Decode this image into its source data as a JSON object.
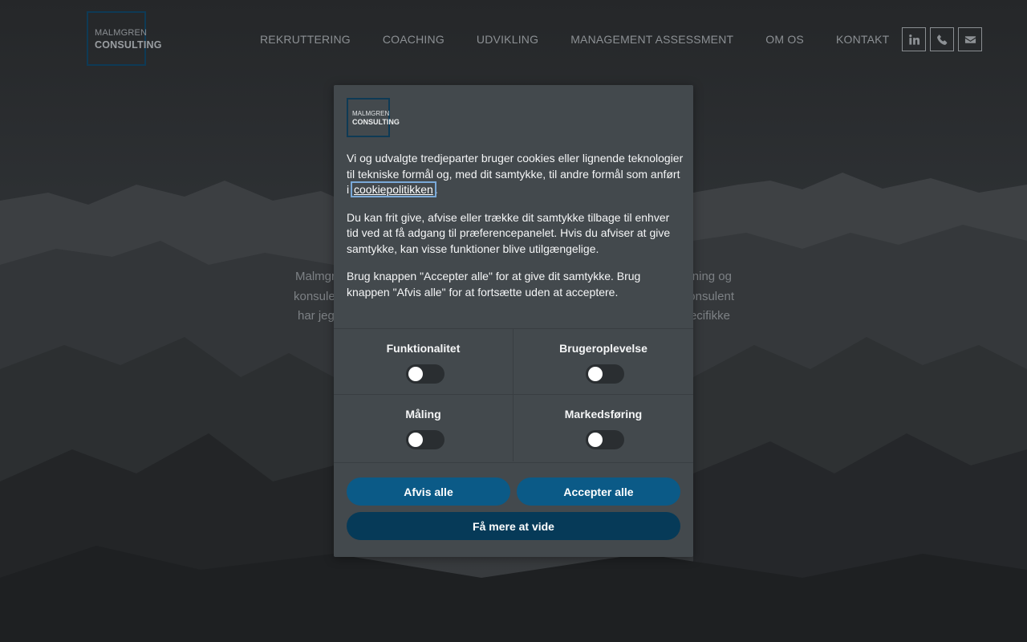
{
  "header": {
    "logo": {
      "line1": "MALMGREN",
      "line2": "CONSULTING"
    },
    "nav": [
      "REKRUTTERING",
      "COACHING",
      "UDVIKLING",
      "MANAGEMENT ASSESSMENT",
      "OM OS",
      "KONTAKT"
    ],
    "social_icons": [
      "linkedin-icon",
      "phone-icon",
      "envelope-icon"
    ]
  },
  "hero": {
    "partial_lines": [
      {
        "left": "Malmgr",
        "right": "ning og"
      },
      {
        "left": "konsule",
        "right": "onsulent"
      },
      {
        "left": "har jeg",
        "right": "ecifikke"
      }
    ]
  },
  "modal": {
    "logo": {
      "line1": "MALMGREN",
      "line2": "CONSULTING"
    },
    "para1_before_link": "Vi og udvalgte tredjeparter bruger cookies eller lignende teknologier til tekniske formål og, med dit samtykke, til andre formål som anført i ",
    "para1_link": "cookiepolitikken",
    "para1_after_link": ".",
    "para2": "Du kan frit give, afvise eller trække dit samtykke tilbage til enhver tid ved at få adgang til præferencepanelet. Hvis du afviser at give samtykke, kan visse funktioner blive utilgængelige.",
    "para3": "Brug knappen \"Accepter alle\" for at give dit samtykke. Brug knappen \"Afvis alle\" for at fortsætte uden at acceptere.",
    "toggles": [
      {
        "label": "Funktionalitet",
        "enabled": false
      },
      {
        "label": "Brugeroplevelse",
        "enabled": false
      },
      {
        "label": "Måling",
        "enabled": false
      },
      {
        "label": "Markedsføring",
        "enabled": false
      }
    ],
    "buttons": {
      "reject": "Afvis alle",
      "accept": "Accepter alle",
      "learn_more": "Få mere at vide"
    }
  },
  "colors": {
    "modal_bg": "#43494d",
    "button_primary": "#0b5a87",
    "button_dark": "#063a58",
    "logo_border": "#0e3a55"
  }
}
